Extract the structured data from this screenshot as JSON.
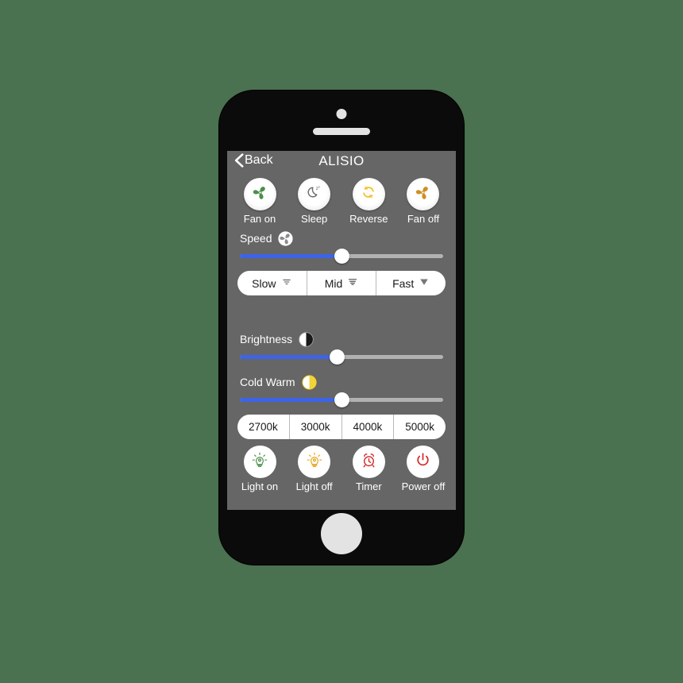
{
  "background_color": "#4a7150",
  "device": {
    "name": "smartphone-mockup",
    "frame_color": "#0b0b0b",
    "screen_background": "#666666"
  },
  "nav": {
    "back_label": "Back",
    "back_icon": "chevron-left-icon",
    "title": "ALISIO"
  },
  "fan_controls": [
    {
      "label": "Fan on",
      "icon": "fan-icon",
      "icon_color": "#4a8f4a"
    },
    {
      "label": "Sleep",
      "icon": "moon-zzz-icon",
      "icon_color": "#6b6b6b"
    },
    {
      "label": "Reverse",
      "icon": "reverse-arrows-icon",
      "icon_color": "#f2c12e"
    },
    {
      "label": "Fan off",
      "icon": "fan-icon",
      "icon_color": "#cf8f23"
    }
  ],
  "speed": {
    "label": "Speed",
    "icon": "fan-small-icon",
    "value_percent": 50,
    "fill_color": "#3d64e8",
    "track_color": "#b2b2b2"
  },
  "speed_presets": [
    {
      "label": "Slow",
      "icon": "wind-weak-icon"
    },
    {
      "label": "Mid",
      "icon": "wind-medium-icon"
    },
    {
      "label": "Fast",
      "icon": "wind-strong-icon"
    }
  ],
  "brightness": {
    "label": "Brightness",
    "icon": "half-circle-icon",
    "value_percent": 48,
    "fill_color": "#3d64e8",
    "track_color": "#b2b2b2"
  },
  "cold_warm": {
    "label": "Cold Warm",
    "icon": "half-circle-yellow-icon",
    "icon_color": "#f2d338",
    "value_percent": 50,
    "fill_color": "#3d64e8",
    "track_color": "#b2b2b2"
  },
  "color_temperatures": [
    {
      "label": "2700k"
    },
    {
      "label": "3000k"
    },
    {
      "label": "4000k"
    },
    {
      "label": "5000k"
    }
  ],
  "light_controls": [
    {
      "label": "Light on",
      "icon": "bulb-on-icon",
      "icon_color": "#4a8f4a"
    },
    {
      "label": "Light off",
      "icon": "bulb-off-icon",
      "icon_color": "#e8a417"
    },
    {
      "label": "Timer",
      "icon": "alarm-clock-icon",
      "icon_color": "#d32b2b"
    },
    {
      "label": "Power off",
      "icon": "power-icon",
      "icon_color": "#d32b2b"
    }
  ]
}
